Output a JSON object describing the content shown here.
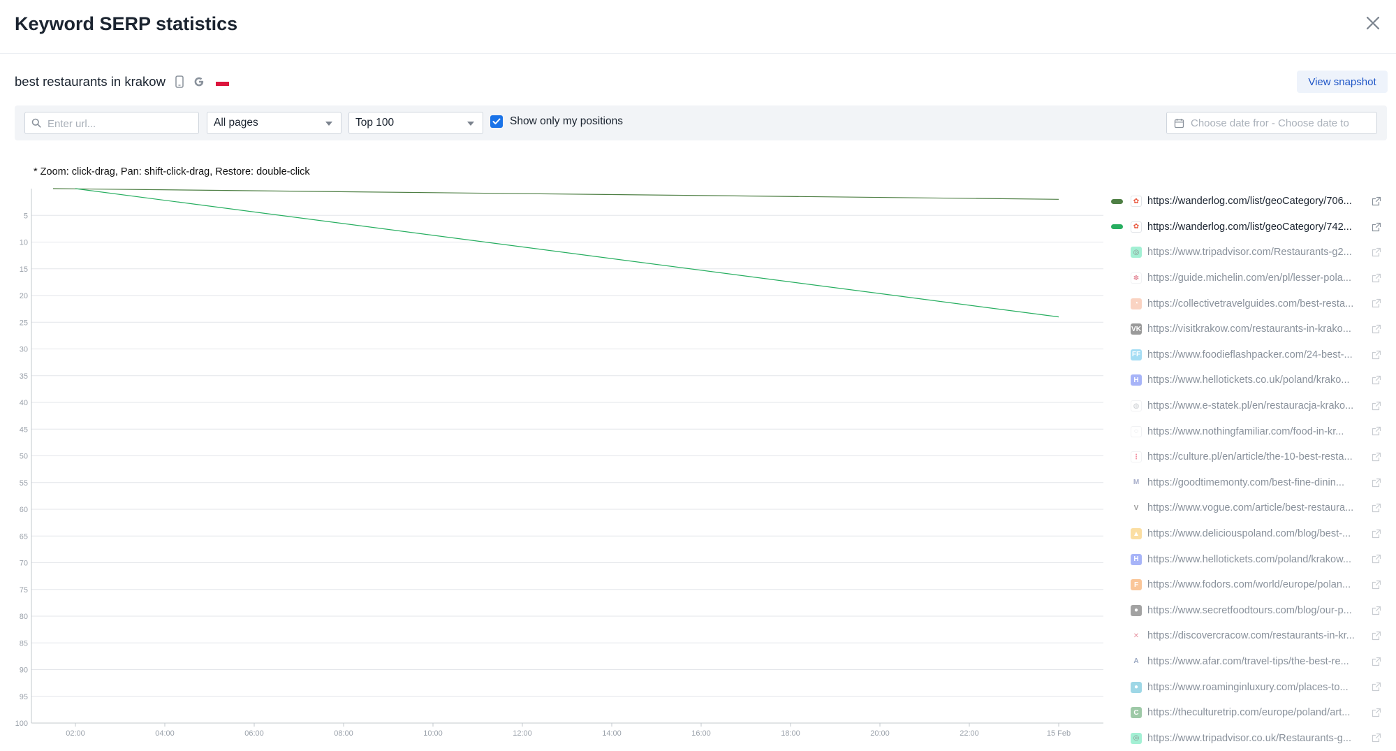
{
  "modal": {
    "title": "Keyword SERP statistics"
  },
  "keyword": {
    "text": "best restaurants in krakow",
    "device_icon": "mobile-icon",
    "engine_icon": "google-icon",
    "country_icon": "poland-flag-icon"
  },
  "actions": {
    "view_snapshot": "View snapshot"
  },
  "filters": {
    "url_placeholder": "Enter url...",
    "pages_selected": "All pages",
    "top_selected": "Top 100",
    "show_only_my_positions": "Show only my positions",
    "show_only_my_positions_checked": true,
    "date_placeholder": "Choose date fror - Choose date to"
  },
  "zoom_note": "* Zoom: click-drag, Pan: shift-click-drag, Restore: double-click",
  "chart_data": {
    "type": "line",
    "y_reversed": true,
    "ylim": [
      0,
      100
    ],
    "y_ticks": [
      5,
      10,
      15,
      20,
      25,
      30,
      35,
      40,
      45,
      50,
      55,
      60,
      65,
      70,
      75,
      80,
      85,
      90,
      95,
      100
    ],
    "x_ticks": [
      "02:00",
      "04:00",
      "06:00",
      "08:00",
      "10:00",
      "12:00",
      "14:00",
      "16:00",
      "18:00",
      "20:00",
      "22:00",
      "15 Feb"
    ],
    "grid": true,
    "series": [
      {
        "name": "https://wanderlog.com/list/geoCategory/706...",
        "color": "#4e7f44",
        "points": [
          [
            "01:30",
            0
          ],
          [
            "24:00",
            2
          ]
        ]
      },
      {
        "name": "https://wanderlog.com/list/geoCategory/742...",
        "color": "#27ae60",
        "points": [
          [
            "02:00",
            0
          ],
          [
            "24:00",
            24
          ]
        ]
      }
    ]
  },
  "legend": [
    {
      "url": "https://wanderlog.com/list/geoCategory/706...",
      "active": true,
      "color": "#4e7f44",
      "icon": "wanderlog-icon"
    },
    {
      "url": "https://wanderlog.com/list/geoCategory/742...",
      "active": true,
      "color": "#27ae60",
      "icon": "wanderlog-icon"
    },
    {
      "url": "https://www.tripadvisor.com/Restaurants-g2...",
      "active": false,
      "icon": "tripadvisor-icon"
    },
    {
      "url": "https://guide.michelin.com/en/pl/lesser-pola...",
      "active": false,
      "icon": "michelin-icon"
    },
    {
      "url": "https://collectivetravelguides.com/best-resta...",
      "active": false,
      "icon": "collectivetravelguides-icon"
    },
    {
      "url": "https://visitkrakow.com/restaurants-in-krako...",
      "active": false,
      "icon": "visitkrakow-icon"
    },
    {
      "url": "https://www.foodieflashpacker.com/24-best-...",
      "active": false,
      "icon": "foodieflashpacker-icon"
    },
    {
      "url": "https://www.hellotickets.co.uk/poland/krako...",
      "active": false,
      "icon": "hellotickets-icon"
    },
    {
      "url": "https://www.e-statek.pl/en/restauracja-krako...",
      "active": false,
      "icon": "globe-icon"
    },
    {
      "url": "https://www.nothingfamiliar.com/food-in-kr...",
      "active": false,
      "icon": "nothingfamiliar-icon"
    },
    {
      "url": "https://culture.pl/en/article/the-10-best-resta...",
      "active": false,
      "icon": "culture-pl-icon"
    },
    {
      "url": "https://goodtimemonty.com/best-fine-dinin...",
      "active": false,
      "icon": "goodtimemonty-icon"
    },
    {
      "url": "https://www.vogue.com/article/best-restaura...",
      "active": false,
      "icon": "vogue-icon"
    },
    {
      "url": "https://www.deliciouspoland.com/blog/best-...",
      "active": false,
      "icon": "deliciouspoland-icon"
    },
    {
      "url": "https://www.hellotickets.com/poland/krakow...",
      "active": false,
      "icon": "hellotickets-icon"
    },
    {
      "url": "https://www.fodors.com/world/europe/polan...",
      "active": false,
      "icon": "fodors-icon"
    },
    {
      "url": "https://www.secretfoodtours.com/blog/our-p...",
      "active": false,
      "icon": "secretfoodtours-icon"
    },
    {
      "url": "https://discovercracow.com/restaurants-in-kr...",
      "active": false,
      "icon": "discovercracow-icon"
    },
    {
      "url": "https://www.afar.com/travel-tips/the-best-re...",
      "active": false,
      "icon": "afar-icon"
    },
    {
      "url": "https://www.roaminginluxury.com/places-to...",
      "active": false,
      "icon": "roaminginluxury-icon"
    },
    {
      "url": "https://theculturetrip.com/europe/poland/art...",
      "active": false,
      "icon": "theculturetrip-icon"
    },
    {
      "url": "https://www.tripadvisor.co.uk/Restaurants-g...",
      "active": false,
      "icon": "tripadvisor-icon"
    }
  ]
}
